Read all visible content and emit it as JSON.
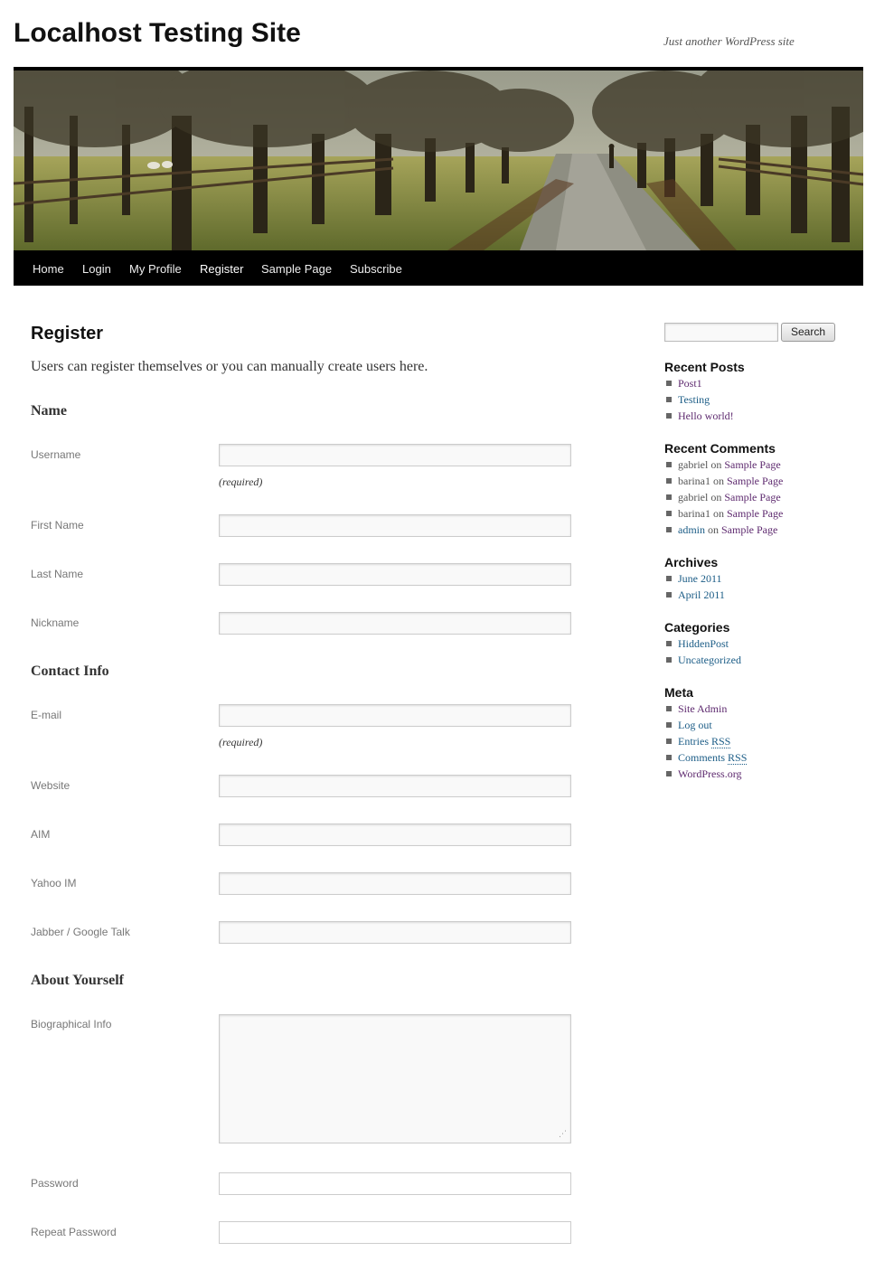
{
  "site": {
    "title": "Localhost Testing Site",
    "tagline": "Just another WordPress site"
  },
  "nav": {
    "items": [
      "Home",
      "Login",
      "My Profile",
      "Register",
      "Sample Page",
      "Subscribe"
    ],
    "current": "Register"
  },
  "page": {
    "title": "Register",
    "intro": "Users can register themselves or you can manually create users here.",
    "required_note": "(required)",
    "sections": {
      "name": "Name",
      "contact": "Contact Info",
      "about": "About Yourself"
    },
    "fields": {
      "username": "Username",
      "first_name": "First Name",
      "last_name": "Last Name",
      "nickname": "Nickname",
      "email": "E-mail",
      "website": "Website",
      "aim": "AIM",
      "yahoo": "Yahoo IM",
      "jabber": "Jabber / Google Talk",
      "bio": "Biographical Info",
      "password": "Password",
      "repeat_password": "Repeat Password"
    }
  },
  "sidebar": {
    "search_button": "Search",
    "recent_posts": {
      "title": "Recent Posts",
      "items": [
        "Post1",
        "Testing",
        "Hello world!"
      ]
    },
    "recent_comments": {
      "title": "Recent Comments",
      "connector": "on",
      "items": [
        {
          "author": "gabriel",
          "post": "Sample Page"
        },
        {
          "author": "barina1",
          "post": "Sample Page"
        },
        {
          "author": "gabriel",
          "post": "Sample Page"
        },
        {
          "author": "barina1",
          "post": "Sample Page"
        },
        {
          "author": "admin",
          "post": "Sample Page"
        }
      ]
    },
    "archives": {
      "title": "Archives",
      "items": [
        "June 2011",
        "April 2011"
      ]
    },
    "categories": {
      "title": "Categories",
      "items": [
        "HiddenPost",
        "Uncategorized"
      ]
    },
    "meta": {
      "title": "Meta",
      "items": {
        "site_admin": "Site Admin",
        "log_out": "Log out",
        "entries": "Entries",
        "comments": "Comments",
        "rss": "RSS",
        "wordpress": "WordPress.org"
      }
    }
  },
  "colors": {
    "link_visited": "#5e2a6f",
    "link": "#1b5c86",
    "nav_background": "#000000"
  }
}
